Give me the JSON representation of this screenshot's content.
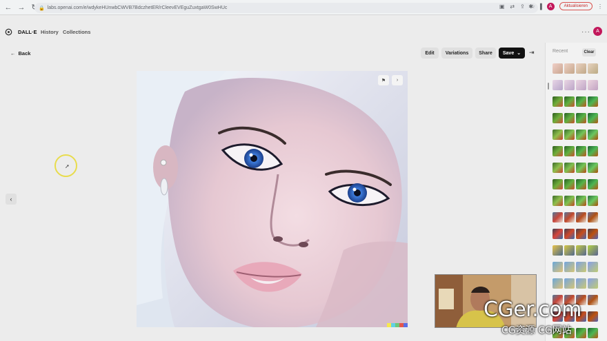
{
  "browser": {
    "url": "labs.openai.com/e/wdykeHUnwbCWVB7BdczhetER/rCleevEVEguZuxtgaW0SwHUc",
    "update_label": "Aktualisieren",
    "avatar_letter": "A"
  },
  "header": {
    "brand": "DALL·E",
    "nav": [
      "History",
      "Collections"
    ],
    "avatar_letter": "A"
  },
  "toolbar": {
    "back_label": "Back",
    "edit_label": "Edit",
    "variations_label": "Variations",
    "share_label": "Share",
    "save_label": "Save"
  },
  "right_panel": {
    "title": "Recent",
    "clear_label": "Clear"
  },
  "watermark": {
    "main": "CGer.com",
    "sub": "CG资源 CG网站"
  },
  "colors": {
    "accent_avatar": "#c2185b",
    "save_bg": "#111111",
    "cursor_ring": "#e8dc4c"
  }
}
